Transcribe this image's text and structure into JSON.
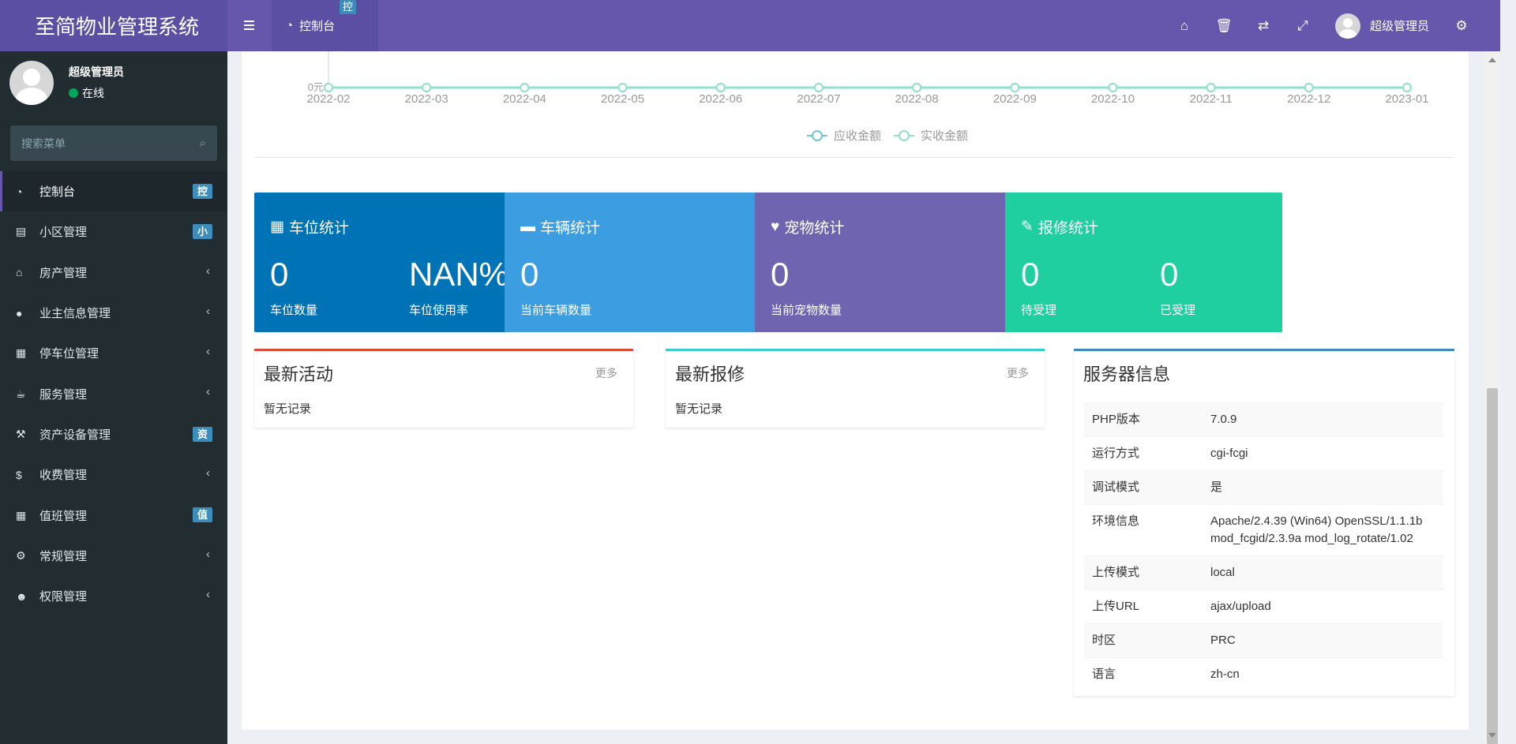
{
  "app": {
    "title": "至简物业管理系统"
  },
  "topbar": {
    "tab_label": "控制台",
    "tab_badge": "控",
    "user_name": "超级管理员",
    "icons": [
      "home-icon",
      "trash-icon",
      "translate-icon",
      "fullscreen-icon",
      "cogs-icon"
    ]
  },
  "sidebar": {
    "user": {
      "name": "超级管理员",
      "status": "在线"
    },
    "search_placeholder": "搜索菜单",
    "items": [
      {
        "label": "控制台",
        "badge": "控",
        "icon": "dashboard-icon"
      },
      {
        "label": "小区管理",
        "badge": "小",
        "icon": "list-icon"
      },
      {
        "label": "房产管理",
        "arrow": "‹",
        "icon": "home-icon"
      },
      {
        "label": "业主信息管理",
        "arrow": "‹",
        "icon": "user-icon"
      },
      {
        "label": "停车位管理",
        "arrow": "‹",
        "icon": "film-icon"
      },
      {
        "label": "服务管理",
        "arrow": "‹",
        "icon": "coffee-icon"
      },
      {
        "label": "资产设备管理",
        "badge": "资",
        "icon": "gavel-icon"
      },
      {
        "label": "收费管理",
        "arrow": "‹",
        "icon": "dollar-icon"
      },
      {
        "label": "值班管理",
        "badge": "值",
        "icon": "calendar-icon"
      },
      {
        "label": "常规管理",
        "arrow": "‹",
        "icon": "cogs-icon"
      },
      {
        "label": "权限管理",
        "arrow": "‹",
        "icon": "users-icon"
      }
    ]
  },
  "chart_data": {
    "type": "line",
    "x": [
      "2022-02",
      "2022-03",
      "2022-04",
      "2022-05",
      "2022-06",
      "2022-07",
      "2022-08",
      "2022-09",
      "2022-10",
      "2022-11",
      "2022-12",
      "2023-01"
    ],
    "y_tick": "0元",
    "series": [
      {
        "name": "应收金额",
        "values": [
          0,
          0,
          0,
          0,
          0,
          0,
          0,
          0,
          0,
          0,
          0,
          0
        ],
        "color": "#70c8c8"
      },
      {
        "name": "实收金额",
        "values": [
          0,
          0,
          0,
          0,
          0,
          0,
          0,
          0,
          0,
          0,
          0,
          0
        ],
        "color": "#90e0d0"
      }
    ],
    "legend": "bottom-center"
  },
  "stats": [
    {
      "title": "车位统计",
      "icon": "film-icon",
      "color": "#0073b7",
      "values": [
        {
          "num": "0",
          "label": "车位数量"
        },
        {
          "num": "NAN%",
          "label": "车位使用率"
        }
      ]
    },
    {
      "title": "车辆统计",
      "icon": "truck-icon",
      "color": "#3c9ee0",
      "values": [
        {
          "num": "0",
          "label": "当前车辆数量"
        }
      ]
    },
    {
      "title": "宠物统计",
      "icon": "heart-icon",
      "color": "#6f64b0",
      "values": [
        {
          "num": "0",
          "label": "当前宠物数量"
        }
      ]
    },
    {
      "title": "报修统计",
      "icon": "wrench-icon",
      "color": "#1fcf9f",
      "values": [
        {
          "num": "0",
          "label": "待受理"
        },
        {
          "num": "0",
          "label": "已受理"
        }
      ]
    }
  ],
  "panels": {
    "activity": {
      "title": "最新活动",
      "more": "更多",
      "empty": "暂无记录",
      "color": "#dd4b39"
    },
    "repair": {
      "title": "最新报修",
      "more": "更多",
      "empty": "暂无记录",
      "color": "#39cccc"
    },
    "server": {
      "title": "服务器信息",
      "color": "#3c8dbc",
      "rows": [
        {
          "k": "PHP版本",
          "v": "7.0.9"
        },
        {
          "k": "运行方式",
          "v": "cgi-fcgi"
        },
        {
          "k": "调试模式",
          "v": "是"
        },
        {
          "k": "环境信息",
          "v": "Apache/2.4.39 (Win64) OpenSSL/1.1.1b mod_fcgid/2.3.9a mod_log_rotate/1.02"
        },
        {
          "k": "上传模式",
          "v": "local"
        },
        {
          "k": "上传URL",
          "v": "ajax/upload"
        },
        {
          "k": "时区",
          "v": "PRC"
        },
        {
          "k": "语言",
          "v": "zh-cn"
        }
      ]
    }
  }
}
